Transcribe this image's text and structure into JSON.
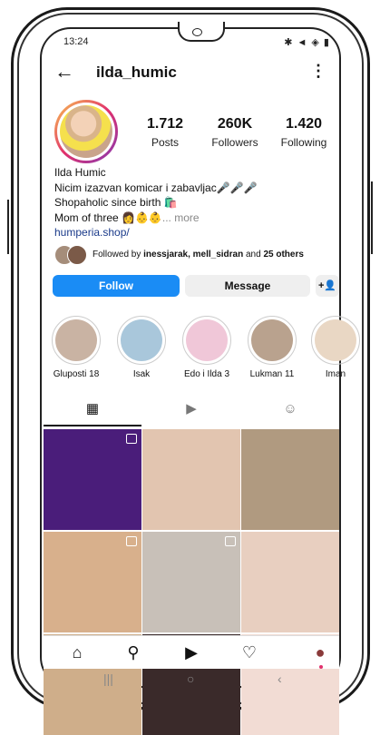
{
  "status_bar": {
    "time": "13:24",
    "right_icons": "✱ ◄ ◈ ▮"
  },
  "header": {
    "username": "ilda_humic"
  },
  "stats": [
    {
      "value": "1.712",
      "label": "Posts"
    },
    {
      "value": "260K",
      "label": "Followers"
    },
    {
      "value": "1.420",
      "label": "Following"
    }
  ],
  "bio": {
    "name": "Ilda Humic",
    "line1": "Nicim izazvan komicar  i zabavljac🎤🎤🎤",
    "line2": "Shopaholic since birth 🛍️",
    "line3": "Mom of three 👩👶👶",
    "more": "... more",
    "link": "humperia.shop/"
  },
  "followed_by": {
    "prefix": "Followed by ",
    "names": "inessjarak, mell_sidran",
    "mid": " and ",
    "others": "25 others"
  },
  "buttons": {
    "follow": "Follow",
    "message": "Message",
    "add_icon": "+👤"
  },
  "highlights": [
    {
      "label": "Gluposti 18",
      "color": "#c9b3a3"
    },
    {
      "label": "Isak",
      "color": "#a9c7db"
    },
    {
      "label": "Edo i Ilda 3",
      "color": "#f0c7d8"
    },
    {
      "label": "Lukman 11",
      "color": "#b9a28e"
    },
    {
      "label": "Iman",
      "color": "#e9d7c4"
    }
  ],
  "tabs": {
    "grid": "▦",
    "reels": "▶",
    "tagged": "☺"
  },
  "grid_posts": [
    {
      "color": "#4a1d7a",
      "reel": true
    },
    {
      "color": "#e2c5b0",
      "reel": false
    },
    {
      "color": "#b09a80",
      "reel": false
    },
    {
      "color": "#d8b08c",
      "reel": true
    },
    {
      "color": "#c8c0b8",
      "reel": true
    },
    {
      "color": "#e8cfc0",
      "reel": false
    },
    {
      "color": "#cfae8a",
      "reel": false
    },
    {
      "color": "#3a2a2a",
      "reel": false
    },
    {
      "color": "#f2dcd4",
      "reel": false
    }
  ],
  "bottom_nav": {
    "home": "⌂",
    "search": "⚲",
    "reels": "▶",
    "likes": "♡",
    "profile": "●"
  },
  "android_nav": {
    "recents": "|||",
    "home": "○",
    "back": "‹"
  }
}
